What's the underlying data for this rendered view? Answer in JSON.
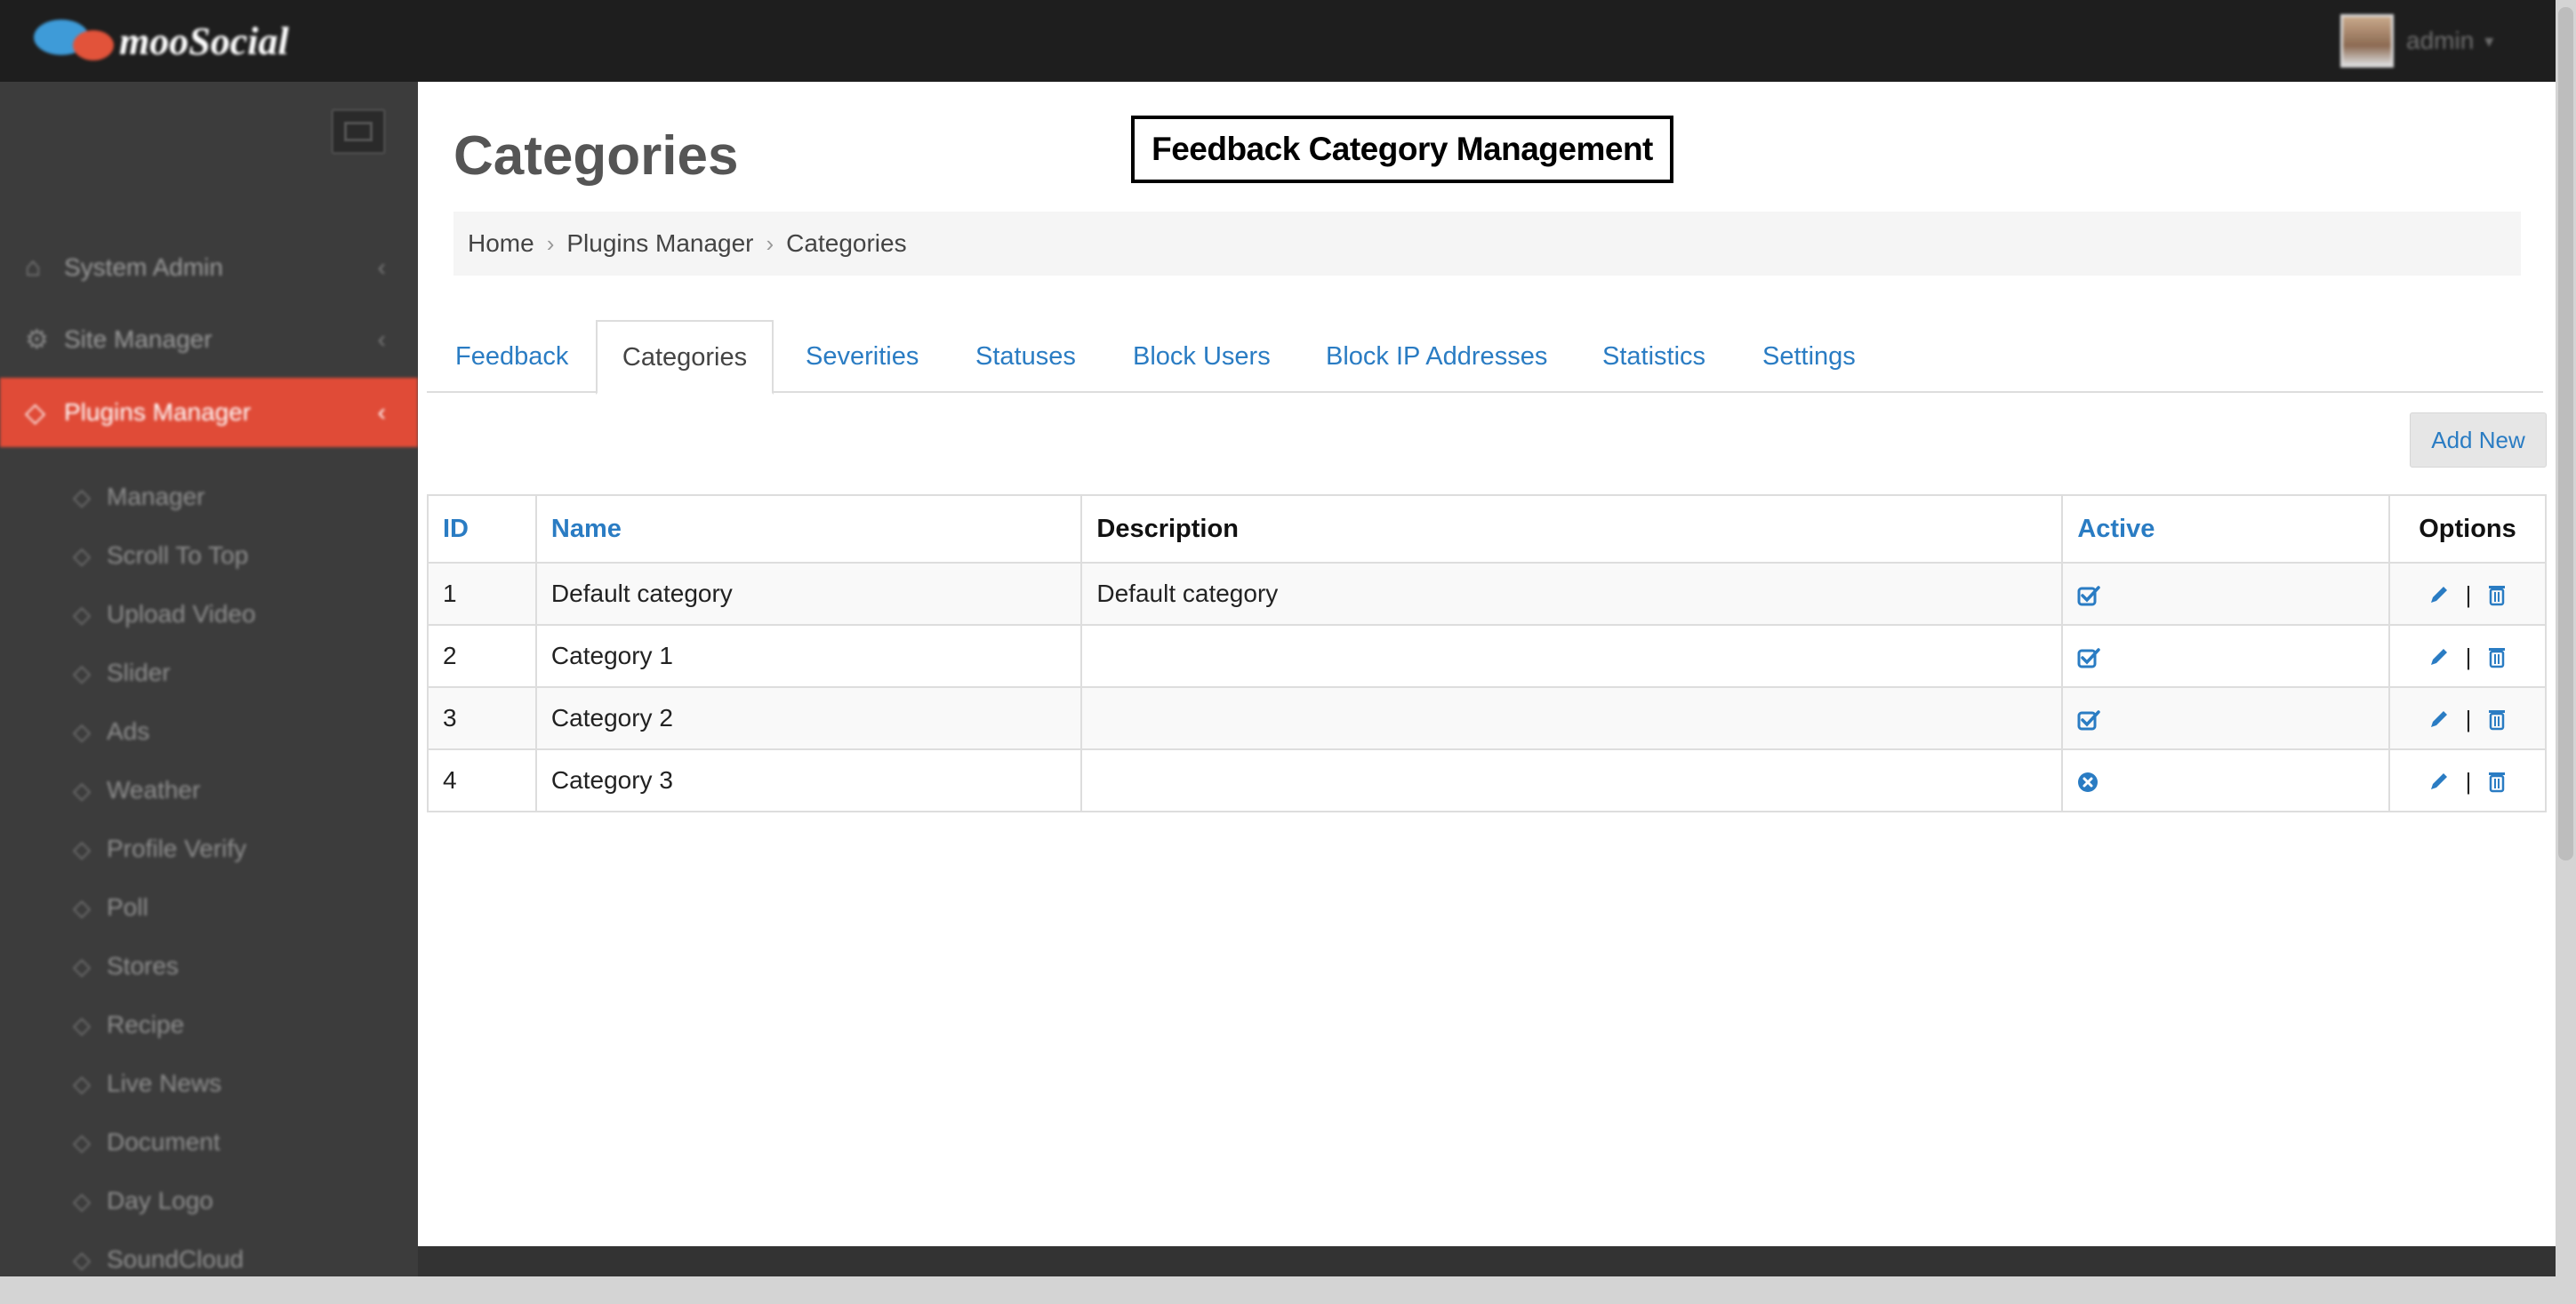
{
  "brand": {
    "name": "mooSocial"
  },
  "user": {
    "name": "admin"
  },
  "sidebar": {
    "items": [
      {
        "label": "System Admin",
        "icon": "home-icon",
        "active": false
      },
      {
        "label": "Site Manager",
        "icon": "cogs-icon",
        "active": false
      },
      {
        "label": "Plugins Manager",
        "icon": "tag-icon",
        "active": true
      }
    ],
    "subitems": [
      "Manager",
      "Scroll To Top",
      "Upload Video",
      "Slider",
      "Ads",
      "Weather",
      "Profile Verify",
      "Poll",
      "Stores",
      "Recipe",
      "Live News",
      "Document",
      "Day Logo",
      "SoundCloud"
    ]
  },
  "page": {
    "title": "Categories",
    "label": "Feedback Category Management"
  },
  "breadcrumb": [
    "Home",
    "Plugins Manager",
    "Categories"
  ],
  "tabs": [
    {
      "label": "Feedback",
      "active": false
    },
    {
      "label": "Categories",
      "active": true
    },
    {
      "label": "Severities",
      "active": false
    },
    {
      "label": "Statuses",
      "active": false
    },
    {
      "label": "Block Users",
      "active": false
    },
    {
      "label": "Block IP Addresses",
      "active": false
    },
    {
      "label": "Statistics",
      "active": false
    },
    {
      "label": "Settings",
      "active": false
    }
  ],
  "toolbar": {
    "add_new_label": "Add New"
  },
  "table": {
    "headers": {
      "id": "ID",
      "name": "Name",
      "description": "Description",
      "active": "Active",
      "options": "Options"
    },
    "rows": [
      {
        "id": "1",
        "name": "Default category",
        "description": "Default category",
        "active": true
      },
      {
        "id": "2",
        "name": "Category 1",
        "description": "",
        "active": true
      },
      {
        "id": "3",
        "name": "Category 2",
        "description": "",
        "active": true
      },
      {
        "id": "4",
        "name": "Category 3",
        "description": "",
        "active": false
      }
    ],
    "option_separator": "|"
  },
  "colors": {
    "accent": "#2a7cc3",
    "active_nav": "#e04b37",
    "topbar": "#1e1e1e",
    "sidebar": "#3c3c3c"
  }
}
